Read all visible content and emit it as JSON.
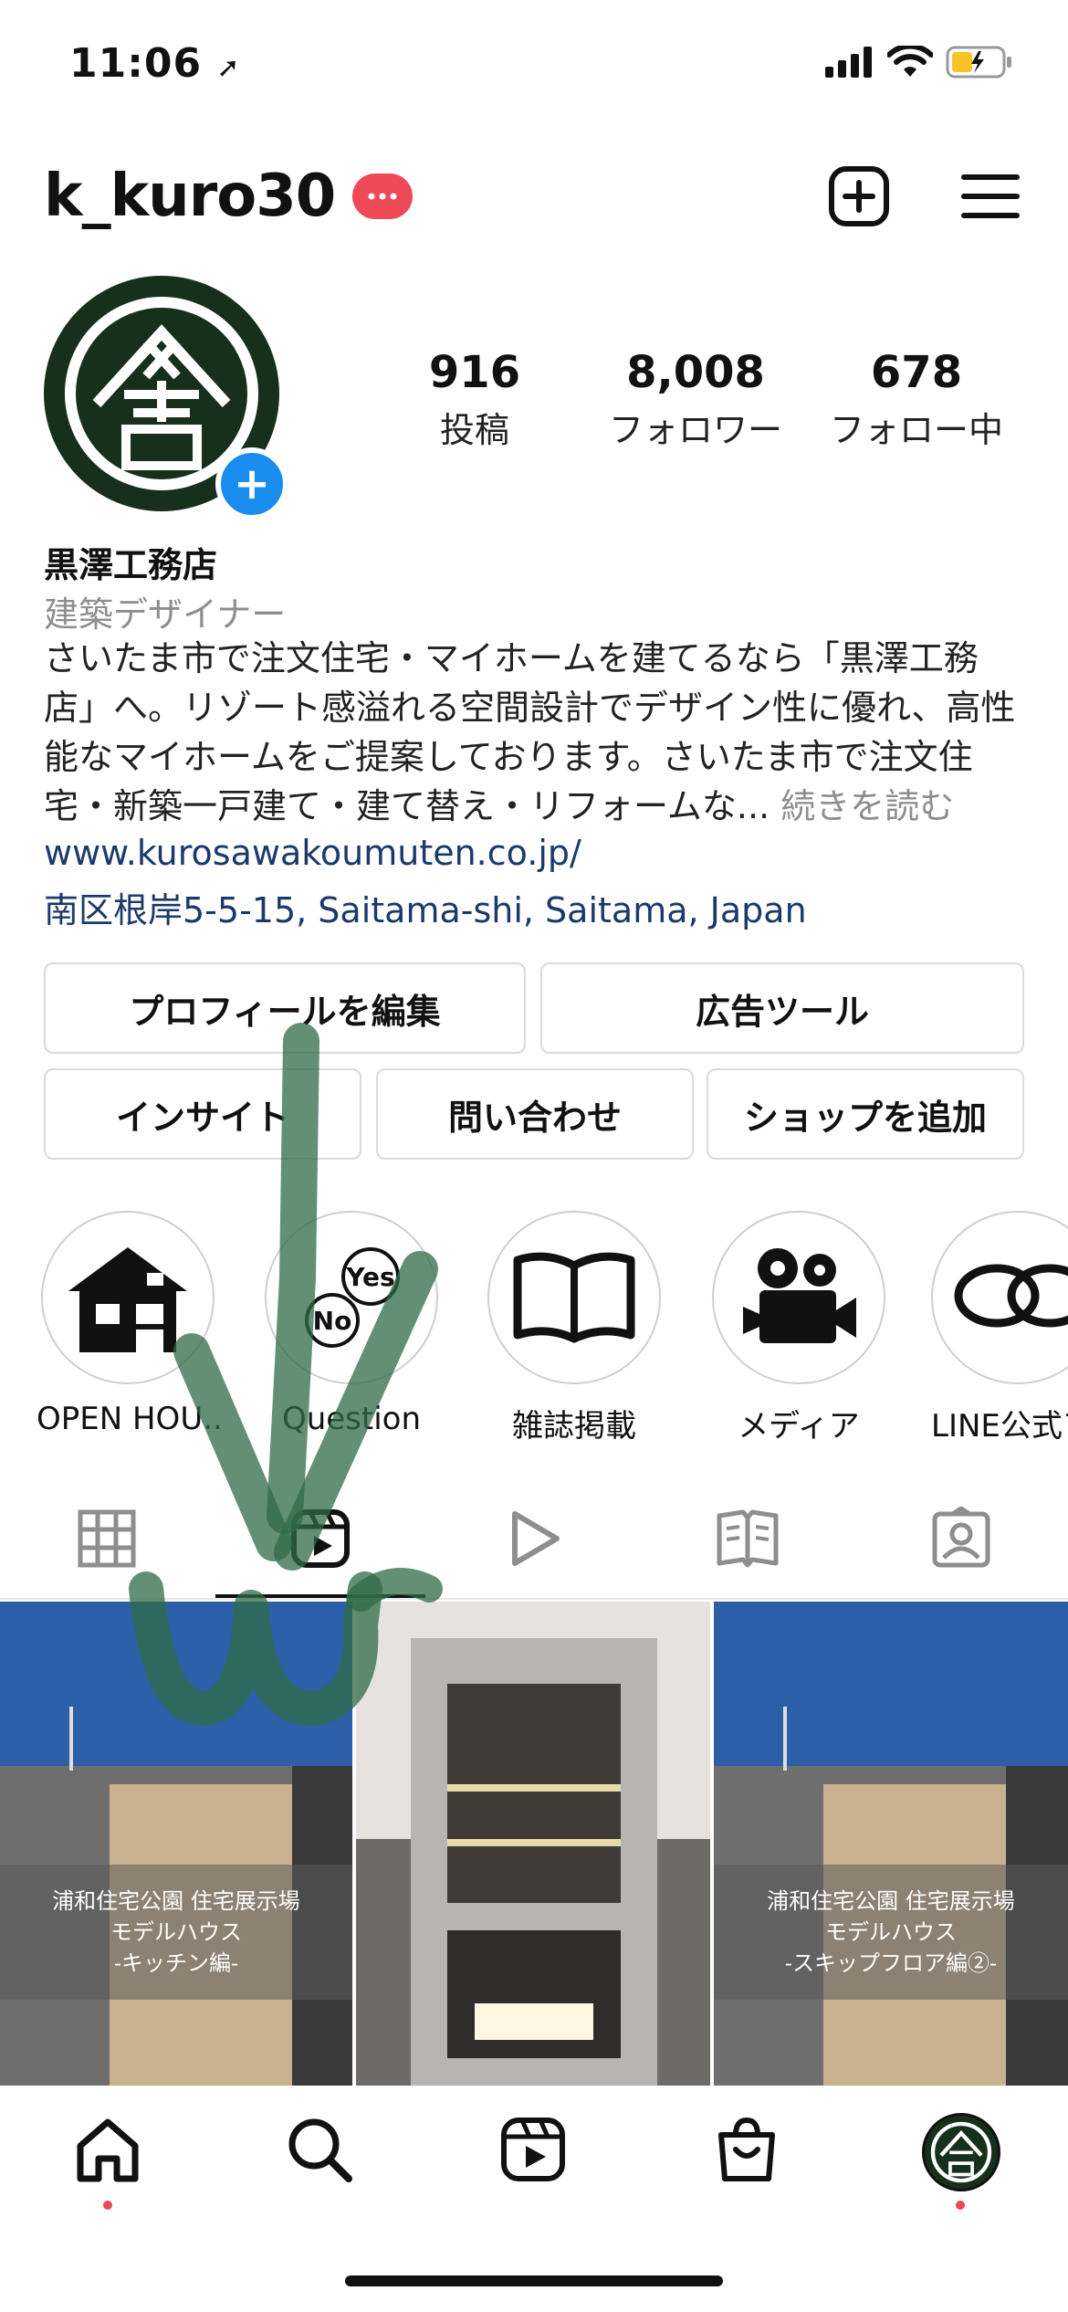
{
  "status_bar": {
    "time": "11:06"
  },
  "header": {
    "username": "k_kuro30",
    "new_post_icon": "plus-square-icon",
    "menu_icon": "hamburger-icon"
  },
  "profile": {
    "stats": [
      {
        "value": "916",
        "label": "投稿"
      },
      {
        "value": "8,008",
        "label": "フォロワー"
      },
      {
        "value": "678",
        "label": "フォロー中"
      }
    ],
    "name": "黒澤工務店",
    "category": "建築デザイナー",
    "bio": "さいたま市で注文住宅・マイホームを建てるなら「黒澤工務店」へ。リゾート感溢れる空間設計でデザイン性に優れ、高性能なマイホームをご提案しております。さいたま市で注文住宅・新築一戸建て・建て替え・リフォームな...",
    "bio_more": " 続きを読む",
    "website": "www.kurosawakoumuten.co.jp/",
    "location": "南区根岸5-5-15, Saitama-shi, Saitama, Japan"
  },
  "buttons": {
    "edit_profile": "プロフィールを編集",
    "ad_tools": "広告ツール",
    "insights": "インサイト",
    "contact": "問い合わせ",
    "add_shop": "ショップを追加"
  },
  "highlights": [
    {
      "label": "OPEN HOU..."
    },
    {
      "label": "Question"
    },
    {
      "label": "雑誌掲載"
    },
    {
      "label": "メディア"
    },
    {
      "label": "LINE公式ア"
    }
  ],
  "grid": [
    {
      "caption": [
        "浦和住宅公園 住宅展示場",
        "モデルハウス",
        "-キッチン編-"
      ]
    },
    {
      "caption": []
    },
    {
      "caption": [
        "浦和住宅公園 住宅展示場",
        "モデルハウス",
        "-スキップフロア編②-"
      ]
    }
  ],
  "colors": {
    "accent_red": "#ed4956",
    "blue_plus": "#1a8cf0",
    "link": "#1b3a6b",
    "logo_green": "#16301c"
  }
}
